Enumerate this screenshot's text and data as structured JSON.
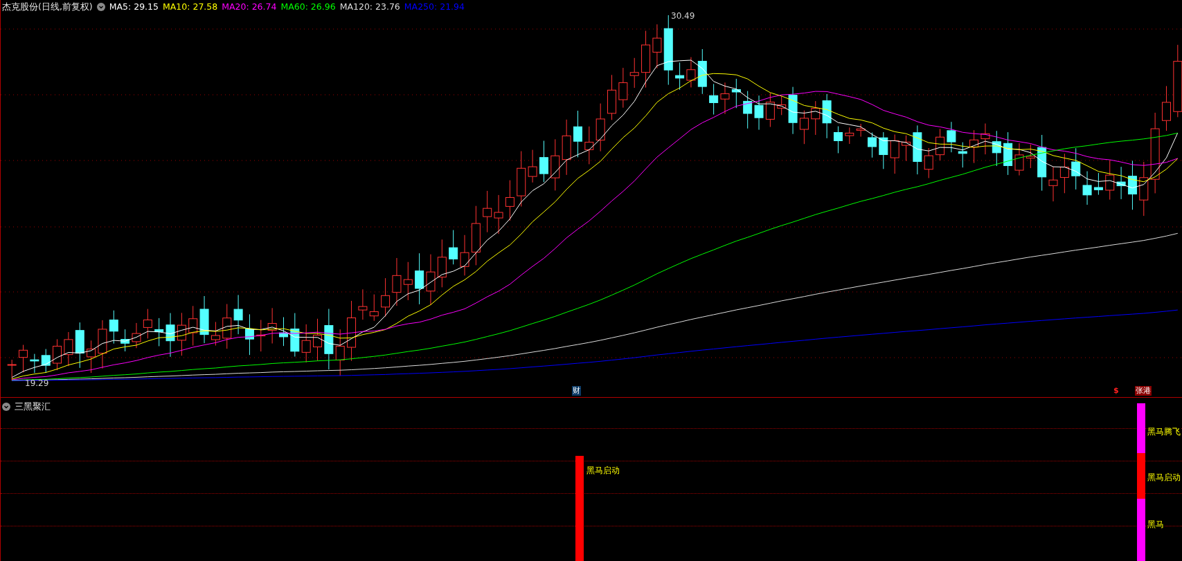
{
  "header": {
    "title": "杰克股份(日线,前复权)",
    "indicators": [
      {
        "label": "MA5: 29.15",
        "color": "#ffffff"
      },
      {
        "label": "MA10: 27.58",
        "color": "#ffff00"
      },
      {
        "label": "MA20: 26.74",
        "color": "#ff00ff"
      },
      {
        "label": "MA60: 26.96",
        "color": "#00ff00"
      },
      {
        "label": "MA120: 23.76",
        "color": "#dddddd"
      },
      {
        "label": "MA250: 21.94",
        "color": "#0000ff"
      }
    ]
  },
  "price_labels": {
    "high": "30.49",
    "low": "19.29"
  },
  "markers": [
    {
      "kind": "finance",
      "text": "财"
    },
    {
      "kind": "dollar",
      "text": "$"
    },
    {
      "kind": "news",
      "text": "张港"
    }
  ],
  "indicator_panel": {
    "title": "三黑聚汇",
    "bars": [
      {
        "segments": [
          {
            "color": "#ff0000"
          }
        ],
        "labels": [
          "黑马启动"
        ]
      },
      {
        "segments": [
          {
            "color": "#ff00ff"
          },
          {
            "color": "#ff0000"
          },
          {
            "color": "#ff00ff"
          }
        ],
        "labels": [
          "黑马腾飞",
          "黑马启动",
          "黑马"
        ]
      }
    ]
  }
}
